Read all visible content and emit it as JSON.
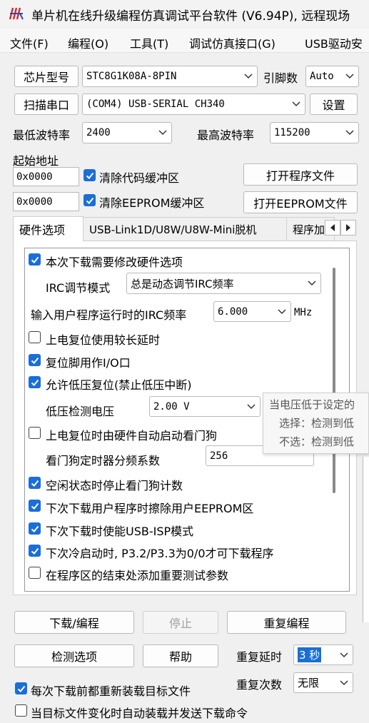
{
  "window": {
    "title": "单片机在线升级编程仿真调试平台软件 (V6.94P), 远程现场"
  },
  "menu": [
    "文件(F)",
    "编程(O)",
    "工具(T)",
    "调试仿真接口(G)",
    "USB驱动安"
  ],
  "chip": {
    "label": "芯片型号",
    "value": "STC8G1K08A-8PIN",
    "pins_label": "引脚数",
    "pins_value": "Auto"
  },
  "port": {
    "scan_label": "扫描串口",
    "value": "(COM4) USB-SERIAL CH340",
    "settings_label": "设置"
  },
  "baud": {
    "min_label": "最低波特率",
    "min_value": "2400",
    "max_label": "最高波特率",
    "max_value": "115200"
  },
  "address": {
    "label": "起始地址",
    "code_addr": "0x0000",
    "clear_code_label": "清除代码缓冲区",
    "open_program_label": "打开程序文件",
    "eeprom_addr": "0x0000",
    "clear_eeprom_label": "清除EEPROM缓冲区",
    "open_eeprom_label": "打开EEPROM文件"
  },
  "tabs": [
    "硬件选项",
    "USB-Link1D/U8W/U8W-Mini脱机",
    "程序加"
  ],
  "hardware": {
    "modify_hw_label": "本次下载需要修改硬件选项",
    "irc_mode_label": "IRC调节模式",
    "irc_mode_value": "总是动态调节IRC频率",
    "irc_freq_label": "输入用户程序运行时的IRC频率",
    "irc_freq_value": "6.000",
    "irc_freq_unit": "MHz",
    "long_delay_label": "上电复位使用较长延时",
    "reset_io_label": "复位脚用作I/O口",
    "lvr_label": "允许低压复位(禁止低压中断)",
    "lvd_label": "低压检测电压",
    "lvd_value": "2.00 V",
    "wdt_auto_label": "上电复位时由硬件自动启动看门狗",
    "wdt_div_label": "看门狗定时器分频系数",
    "wdt_div_value": "256",
    "wdt_idle_label": "空闲状态时停止看门狗计数",
    "erase_eeprom_label": "下次下载用户程序时擦除用户EEPROM区",
    "usb_isp_label": "下次下载时使能USB-ISP模式",
    "cold_boot_label": "下次冷启动时, P3.2/P3.3为0/0才可下载程序",
    "test_params_label": "在程序区的结束处添加重要测试参数"
  },
  "tooltip": {
    "line1": "当电压低于设定的",
    "line2": "选择：检测到低",
    "line3": "不选：检测到低"
  },
  "actions": {
    "download_label": "下载/编程",
    "stop_label": "停止",
    "repeat_label": "重复编程",
    "check_label": "检测选项",
    "help_label": "帮助",
    "delay_label": "重复延时",
    "delay_value": "3 秒",
    "count_label": "重复次数",
    "count_value": "无限"
  },
  "footer": {
    "reload_label": "每次下载前都重新装载目标文件",
    "auto_send_label": "当目标文件变化时自动装载并发送下载命令"
  },
  "checks": {
    "clear_code": true,
    "clear_eeprom": true,
    "modify_hw": true,
    "long_delay": false,
    "reset_io": true,
    "lvr": true,
    "wdt_auto": false,
    "wdt_idle": true,
    "erase_eeprom": true,
    "usb_isp": true,
    "cold_boot": true,
    "test_params": false,
    "reload": true,
    "auto_send": false
  },
  "colors": {
    "accent": "#1a6ed8",
    "logo_red": "#d8262d"
  }
}
